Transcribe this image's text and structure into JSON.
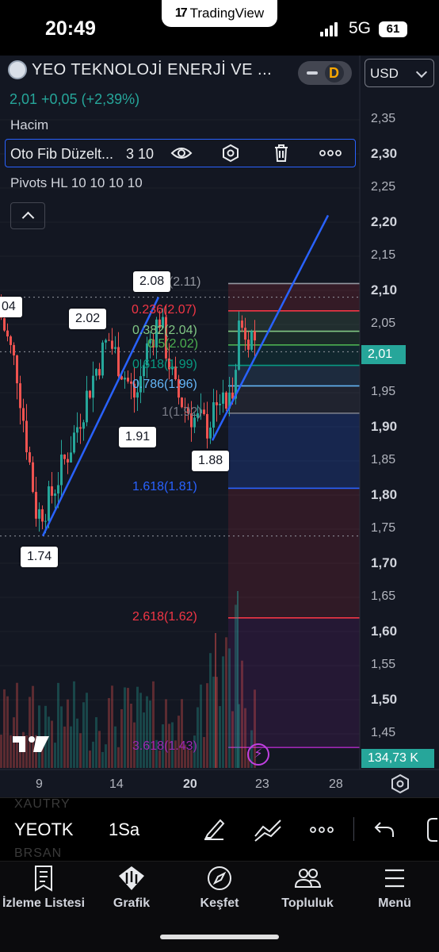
{
  "status_bar": {
    "time": "20:49",
    "network": "5G",
    "battery": "61",
    "tradingview_label": "TradingView"
  },
  "symbol_header": {
    "title": "YEO TEKNOLOJİ ENERJİ VE ...",
    "interval_badge": "D",
    "currency": "USD",
    "price_line": "2,01 +0,05 (+2,39%)"
  },
  "indicators": {
    "volume_label": "Hacim",
    "fib_name": "Oto Fib Düzelt...",
    "fib_params": "3 10",
    "pivots": "Pivots HL 10 10 10 10"
  },
  "price_axis": [
    "2,35",
    "2,30",
    "2,25",
    "2,20",
    "2,15",
    "2,10",
    "2,05",
    "1,95",
    "1,90",
    "1,85",
    "1,80",
    "1,75",
    "1,70",
    "1,65",
    "1,60",
    "1,55",
    "1,50",
    "1,45"
  ],
  "price_axis_bold": [
    "2,30",
    "2,20",
    "2,10",
    "1,90",
    "1,80",
    "1,70",
    "1,60",
    "1,50"
  ],
  "last_price_tag": "2,01",
  "volume_tag": "134,73 K",
  "time_axis": [
    "9",
    "14",
    "20",
    "23",
    "28"
  ],
  "fib_levels": [
    {
      "label": "0(2.11)",
      "color": "#9598a1"
    },
    {
      "label": "0.236(2.07)",
      "color": "#f23645"
    },
    {
      "label": "0.382(2.04)",
      "color": "#81c784"
    },
    {
      "label": "0.5(2.02)",
      "color": "#4caf50"
    },
    {
      "label": "0.618(1.99)",
      "color": "#089981"
    },
    {
      "label": "0.786(1.96)",
      "color": "#64b5f6"
    },
    {
      "label": "1(1.92)",
      "color": "#787b86"
    },
    {
      "label": "1.618(1.81)",
      "color": "#2962ff"
    },
    {
      "label": "2.618(1.62)",
      "color": "#f23645"
    },
    {
      "label": "3.618(1.43)",
      "color": "#9c27b0"
    }
  ],
  "pivot_labels": [
    "04",
    "2.02",
    "2.08",
    "1.91",
    "1.88",
    "1.74"
  ],
  "chart_data": {
    "type": "candlestick",
    "ylim": [
      1.41,
      2.37
    ],
    "x_ticks": [
      "9",
      "14",
      "20",
      "23",
      "28"
    ],
    "last_price": 2.01,
    "last_volume": "134,73 K",
    "pivots": [
      2.02,
      2.08,
      1.91,
      1.88,
      1.74
    ],
    "fib_retracement": [
      {
        "ratio": 0,
        "price": 2.11
      },
      {
        "ratio": 0.236,
        "price": 2.07
      },
      {
        "ratio": 0.382,
        "price": 2.04
      },
      {
        "ratio": 0.5,
        "price": 2.02
      },
      {
        "ratio": 0.618,
        "price": 1.99
      },
      {
        "ratio": 0.786,
        "price": 1.96
      },
      {
        "ratio": 1,
        "price": 1.92
      },
      {
        "ratio": 1.618,
        "price": 1.81
      },
      {
        "ratio": 2.618,
        "price": 1.62
      },
      {
        "ratio": 3.618,
        "price": 1.43
      }
    ],
    "trendlines": [
      {
        "from_price": 1.74,
        "to_price": 2.09
      },
      {
        "from_price": 1.88,
        "to_price": 2.21
      }
    ]
  },
  "toolbar": {
    "symbol": "YEOTK",
    "interval": "1Sa",
    "ghost_above": "XAUTRY",
    "ghost_below": "BRSAN"
  },
  "tabs": [
    {
      "label": "İzleme Listesi"
    },
    {
      "label": "Grafik"
    },
    {
      "label": "Keşfet"
    },
    {
      "label": "Topluluk"
    },
    {
      "label": "Menü"
    }
  ],
  "colors": {
    "up": "#26a69a",
    "down": "#ef5350",
    "trend": "#2962ff",
    "background": "#131722"
  }
}
